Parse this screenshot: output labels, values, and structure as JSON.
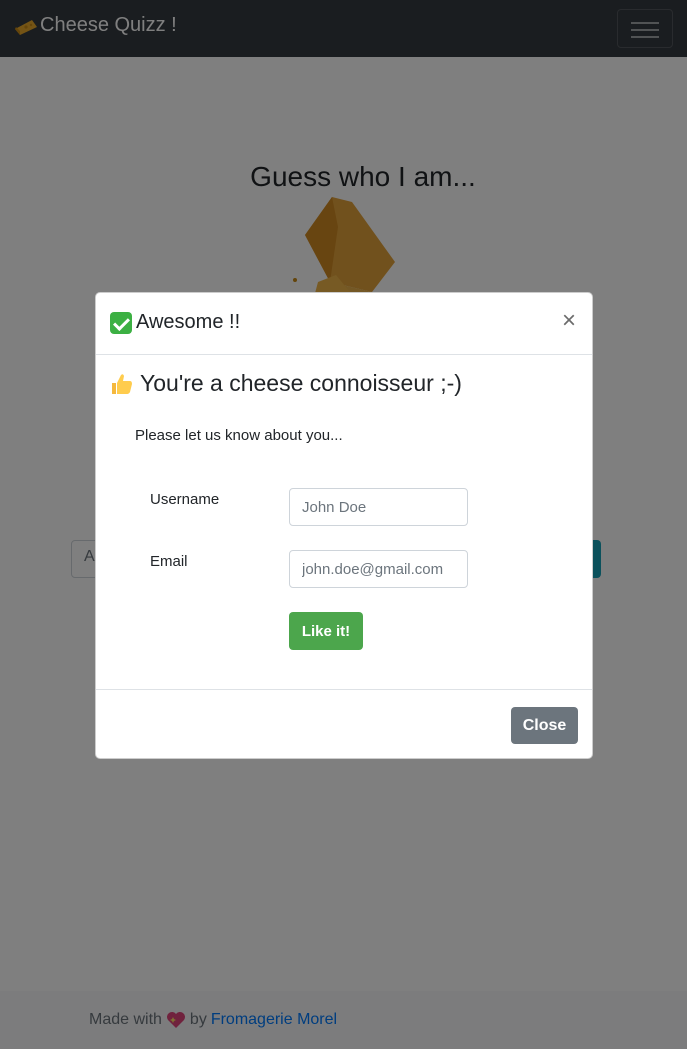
{
  "navbar": {
    "brand": "Cheese Quizz !",
    "brand_icon": "cheese-icon",
    "menu_icon": "hamburger-menu-icon"
  },
  "main": {
    "title": "Guess who I am...",
    "answer_placeholder": "A"
  },
  "footer": {
    "made_with": "Made with",
    "heart_icon": "sparkling-heart-icon",
    "by": "by",
    "link_label": "Fromagerie Morel"
  },
  "modal": {
    "title": "Awesome !!",
    "title_icon": "check-mark-icon",
    "close_symbol": "×",
    "congrats_icon": "thumbs-up-icon",
    "congrats": "You're a cheese connoisseur ;-)",
    "prompt": "Please let us know about you...",
    "username_label": "Username",
    "username_placeholder": "John Doe",
    "email_label": "Email",
    "email_placeholder": "john.doe@gmail.com",
    "submit_label": "Like it!",
    "close_label": "Close"
  },
  "colors": {
    "navbar_bg": "#343a40",
    "success": "#4ca64c",
    "secondary": "#6c757d",
    "link": "#007bff",
    "info": "#17a2b8"
  }
}
